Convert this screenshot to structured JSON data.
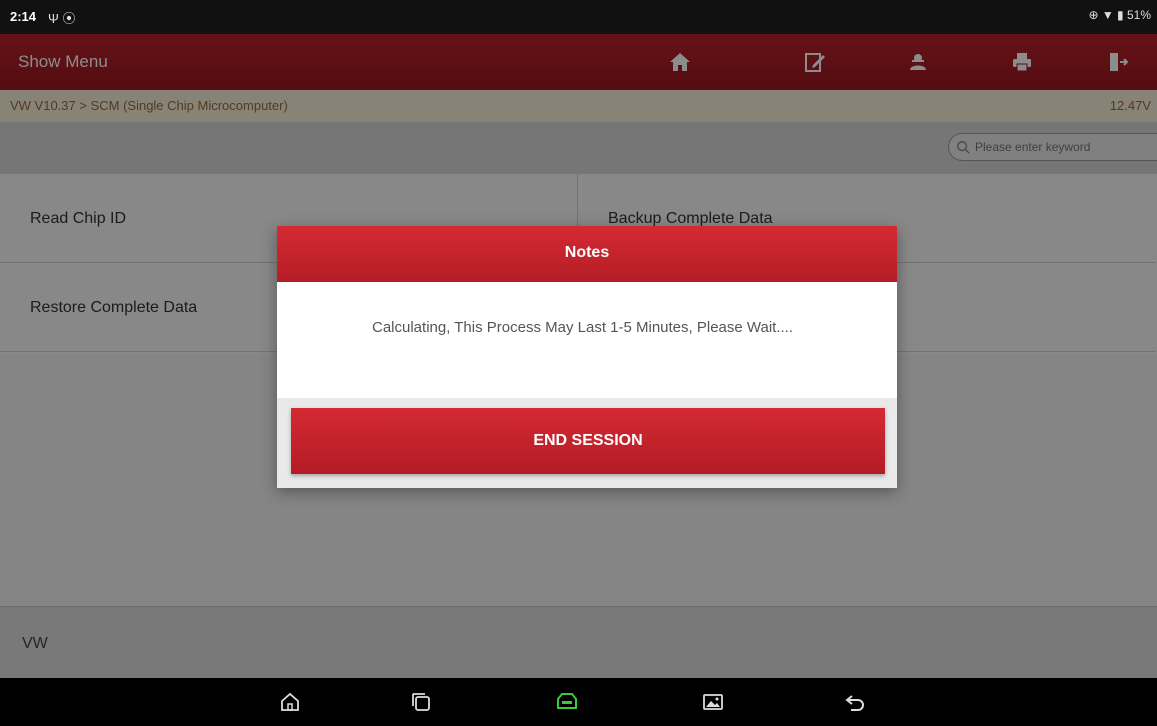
{
  "status_bar": {
    "time": "2:14",
    "left_icons": "Ψ ⦿",
    "right_icons": "⊕ ▼ ▮ 51%"
  },
  "header": {
    "title": "Show Menu",
    "icons": [
      "home-icon",
      "edit-icon",
      "user-icon",
      "print-icon",
      "exit-icon"
    ]
  },
  "breadcrumb": {
    "path": "VW V10.37 > SCM (Single Chip Microcomputer)",
    "voltage": "12.47V"
  },
  "search": {
    "placeholder": "Please enter keyword"
  },
  "menu": {
    "items": [
      {
        "label": "Read Chip ID"
      },
      {
        "label": "Backup Complete Data"
      },
      {
        "label": "Restore Complete Data"
      },
      {
        "label": ""
      }
    ]
  },
  "vehicle": {
    "label": "VW"
  },
  "dialog": {
    "title": "Notes",
    "message": "Calculating, This Process May Last 1-5 Minutes, Please Wait....",
    "button_label": "END SESSION"
  },
  "nav_bar": {
    "icons": [
      "home-nav-icon",
      "recents-icon",
      "vci-icon",
      "screenshot-icon",
      "back-icon"
    ]
  },
  "colors": {
    "header_red": "#9a1820",
    "dialog_red": "#c4232c",
    "accent_green": "#3cc83c"
  }
}
